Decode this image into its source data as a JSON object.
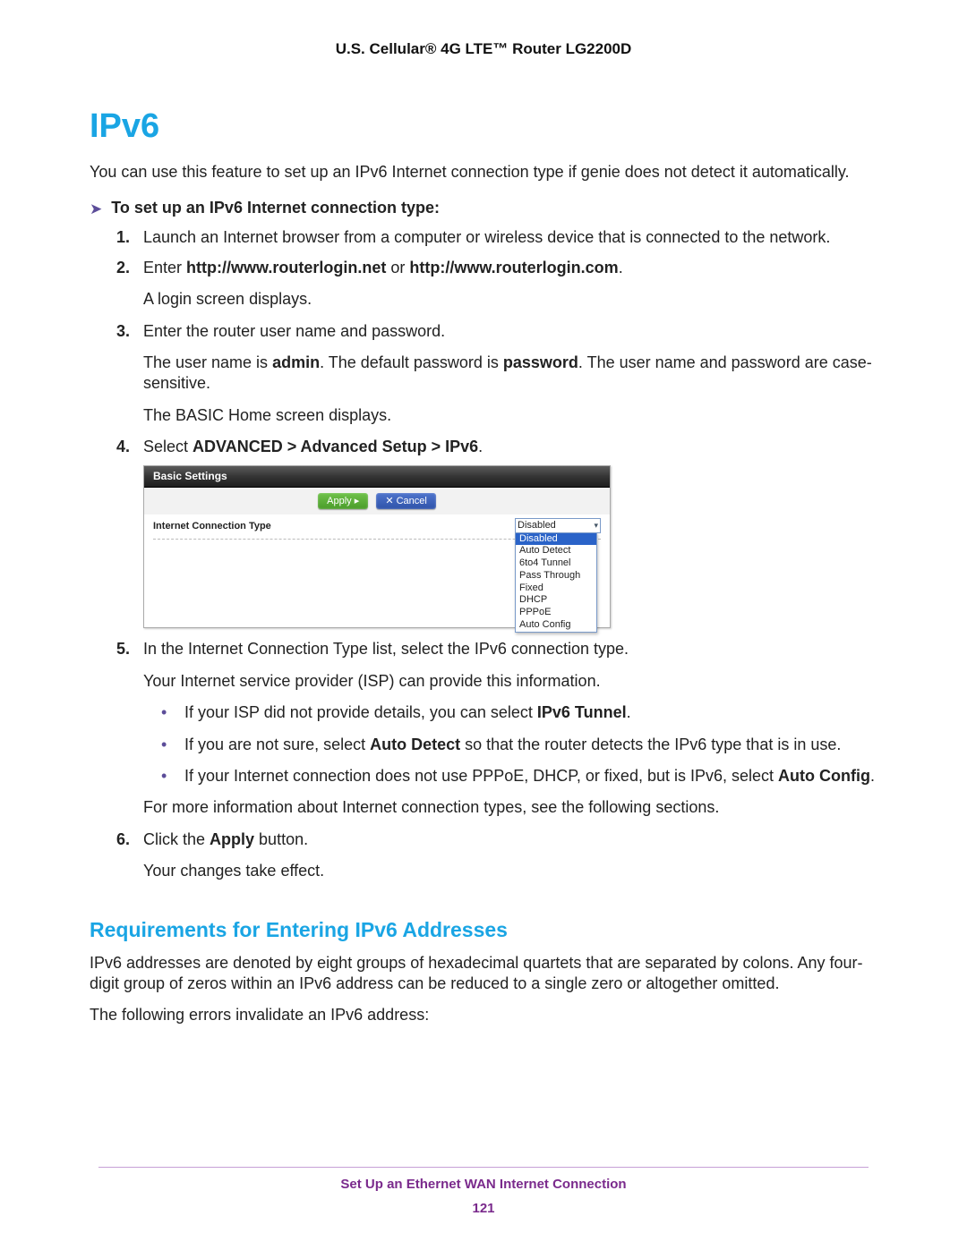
{
  "doc_title": "U.S. Cellular® 4G LTE™ Router LG2200D",
  "h1": "IPv6",
  "intro": "You can use this feature to set up an IPv6 Internet connection type if genie does not detect it automatically.",
  "task_heading": "To set up an IPv6 Internet connection type:",
  "steps": {
    "s1": "Launch an Internet browser from a computer or wireless device that is connected to the network.",
    "s2_prefix": "Enter ",
    "s2_b1": "http://www.routerlogin.net",
    "s2_mid": " or ",
    "s2_b2": "http://www.routerlogin.com",
    "s2_suffix": ".",
    "s2_sub": "A login screen displays.",
    "s3": "Enter the router user name and password.",
    "s3_sub1_a": "The user name is ",
    "s3_sub1_b1": "admin",
    "s3_sub1_b": ". The default password is ",
    "s3_sub1_b2": "password",
    "s3_sub1_c": ". The user name and password are case-sensitive.",
    "s3_sub2": "The BASIC Home screen displays.",
    "s4_a": "Select ",
    "s4_b": "ADVANCED > Advanced Setup > IPv6",
    "s4_c": ".",
    "s5": "In the Internet Connection Type list, select the IPv6 connection type.",
    "s5_sub1": "Your Internet service provider (ISP) can provide this information.",
    "s5_b1_a": "If your ISP did not provide details, you can select ",
    "s5_b1_b": "IPv6 Tunnel",
    "s5_b1_c": ".",
    "s5_b2_a": "If you are not sure, select ",
    "s5_b2_b": "Auto Detect",
    "s5_b2_c": " so that the router detects the IPv6 type that is in use.",
    "s5_b3_a": "If your Internet connection does not use PPPoE, DHCP, or fixed, but is IPv6, select ",
    "s5_b3_b": "Auto Config",
    "s5_b3_c": ".",
    "s5_sub2": "For more information about Internet connection types, see the following sections.",
    "s6_a": "Click the ",
    "s6_b": "Apply",
    "s6_c": " button.",
    "s6_sub": "Your changes take effect."
  },
  "panel": {
    "title": "Basic Settings",
    "apply": "Apply ▸",
    "cancel": "✕ Cancel",
    "label": "Internet Connection Type",
    "selected": "Disabled",
    "options": [
      "Disabled",
      "Auto Detect",
      "6to4 Tunnel",
      "Pass Through",
      "Fixed",
      "DHCP",
      "PPPoE",
      "Auto Config"
    ]
  },
  "h2": "Requirements for Entering IPv6 Addresses",
  "req_p1": "IPv6 addresses are denoted by eight groups of hexadecimal quartets that are separated by colons. Any four-digit group of zeros within an IPv6 address can be reduced to a single zero or altogether omitted.",
  "req_p2": "The following errors invalidate an IPv6 address:",
  "footer": "Set Up an Ethernet WAN Internet Connection",
  "page_number": "121"
}
